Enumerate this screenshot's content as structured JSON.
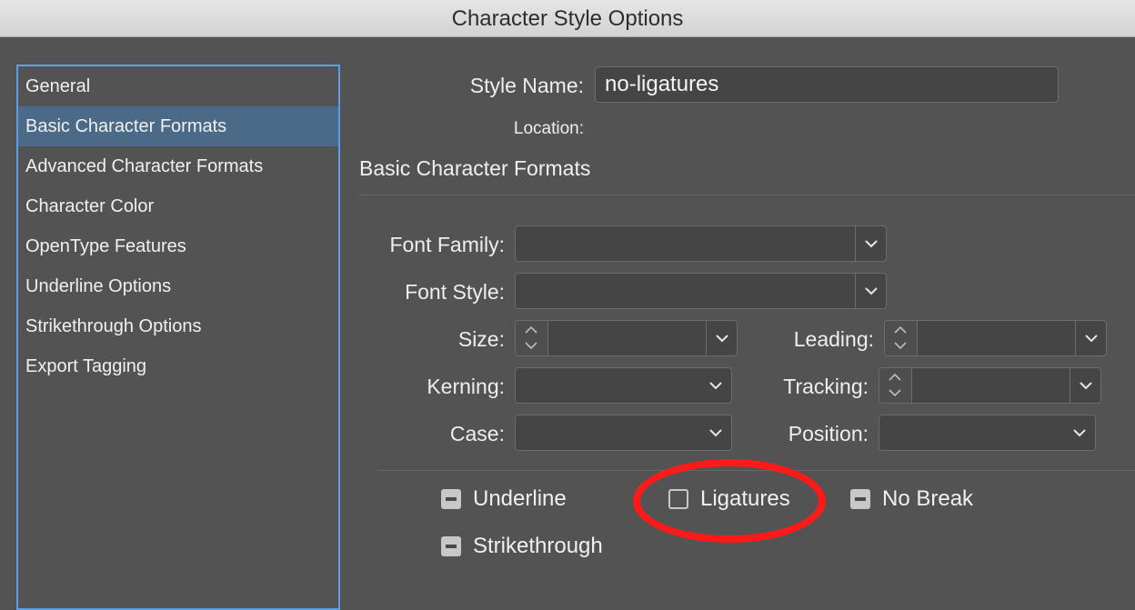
{
  "window": {
    "title": "Character Style Options"
  },
  "sidebar": {
    "items": [
      {
        "label": "General",
        "selected": false
      },
      {
        "label": "Basic Character Formats",
        "selected": true
      },
      {
        "label": "Advanced Character Formats",
        "selected": false
      },
      {
        "label": "Character Color",
        "selected": false
      },
      {
        "label": "OpenType Features",
        "selected": false
      },
      {
        "label": "Underline Options",
        "selected": false
      },
      {
        "label": "Strikethrough Options",
        "selected": false
      },
      {
        "label": "Export Tagging",
        "selected": false
      }
    ]
  },
  "style_name": {
    "label": "Style Name:",
    "value": "no-ligatures"
  },
  "location": {
    "label": "Location:"
  },
  "section": {
    "title": "Basic Character Formats"
  },
  "fields": {
    "font_family": {
      "label": "Font Family:",
      "value": ""
    },
    "font_style": {
      "label": "Font Style:",
      "value": ""
    },
    "size": {
      "label": "Size:",
      "value": ""
    },
    "leading": {
      "label": "Leading:",
      "value": ""
    },
    "kerning": {
      "label": "Kerning:",
      "value": ""
    },
    "tracking": {
      "label": "Tracking:",
      "value": ""
    },
    "case": {
      "label": "Case:",
      "value": ""
    },
    "position": {
      "label": "Position:",
      "value": ""
    }
  },
  "checkboxes": {
    "underline": {
      "label": "Underline",
      "state": "mixed"
    },
    "ligatures": {
      "label": "Ligatures",
      "state": "unchecked"
    },
    "no_break": {
      "label": "No Break",
      "state": "mixed"
    },
    "strikethrough": {
      "label": "Strikethrough",
      "state": "mixed"
    }
  },
  "colors": {
    "dialog_bg": "#535353",
    "selection": "#4a6a88",
    "focus_border": "#5c9ee6",
    "annotation": "#ff1a1a"
  }
}
